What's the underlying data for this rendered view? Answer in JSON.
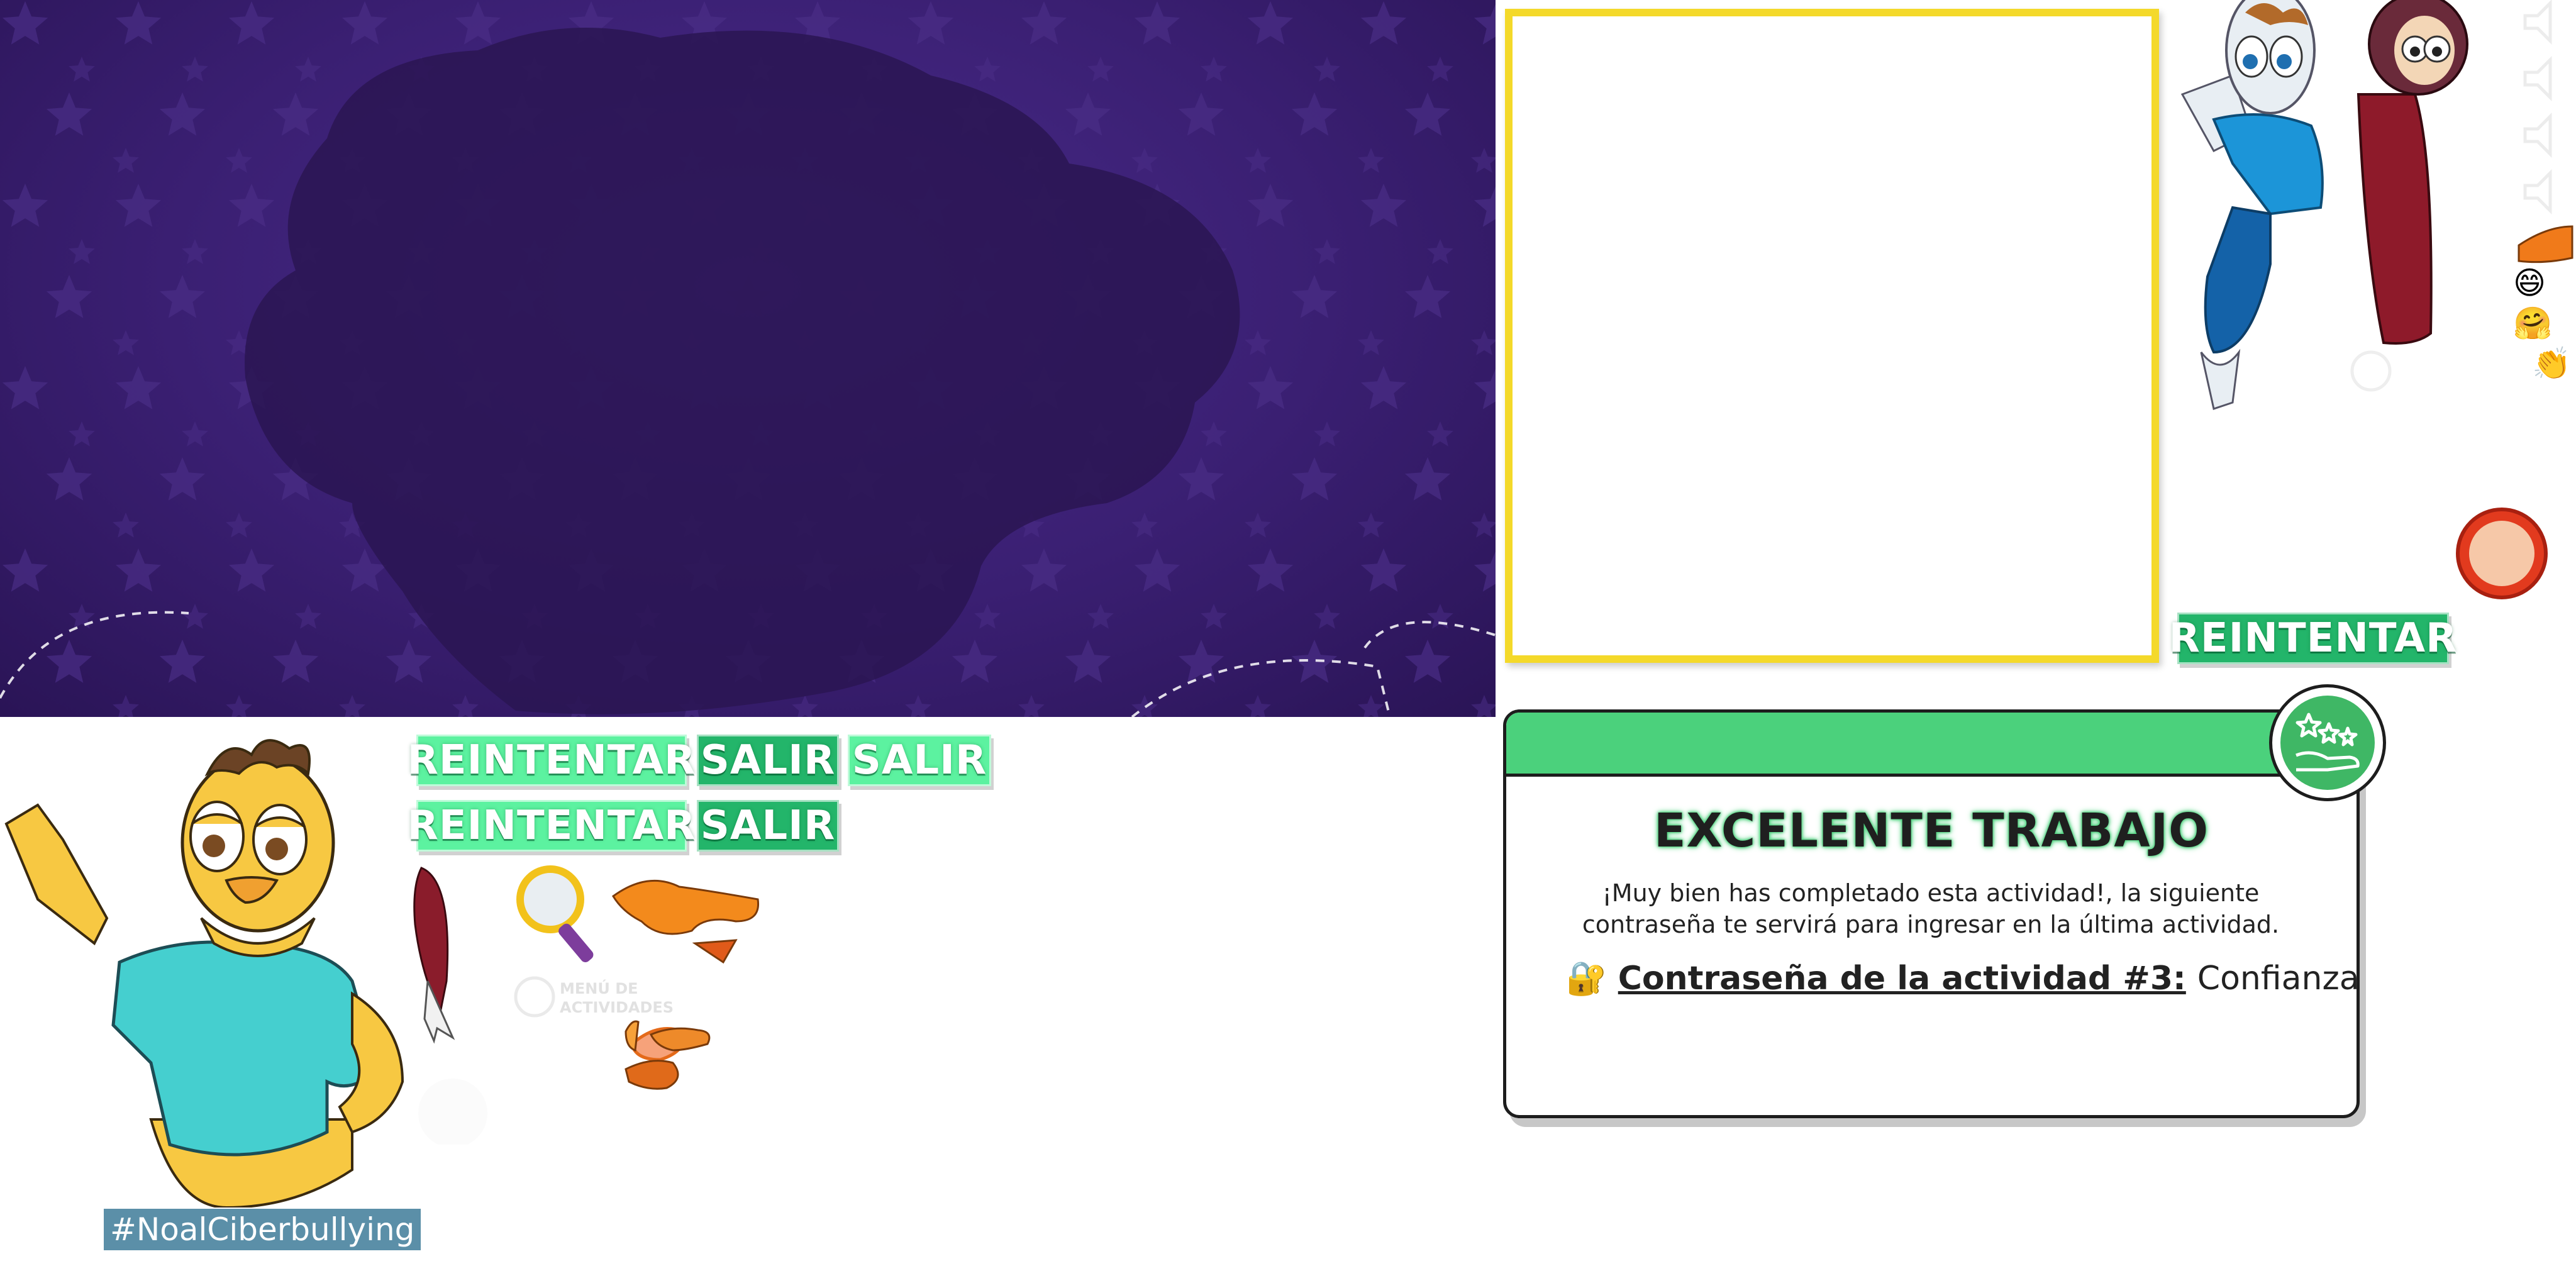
{
  "banner": {
    "background_color": "#3a1f72",
    "blob_color": "#2a1552",
    "star_color": "#4a2d86"
  },
  "buttons": {
    "retry_light": "REINTENTAR",
    "exit_dark_1": "SALIR",
    "exit_light": "SALIR",
    "retry_light_2": "REINTENTAR",
    "exit_dark_2": "SALIR",
    "retry_dark_right": "REINTENTAR"
  },
  "modal": {
    "title": "EXCELENTE TRABAJO",
    "body_line_1": "¡Muy bien has completado esta actividad!, la siguiente",
    "body_line_2": "contraseña te servirá para ingresar en la última actividad.",
    "password_label": "Contraseña de la actividad #3:",
    "password_value": "Confianza",
    "lock_icon": "🔐",
    "header_color": "#4bd17c"
  },
  "hashtag": "#NoalCiberbullying",
  "ghost_menu": {
    "line_1": "MENÚ DE",
    "line_2": "ACTIVIDADES"
  },
  "emojis": {
    "laugh": "😄",
    "hug": "🤗",
    "clap": "👏"
  }
}
